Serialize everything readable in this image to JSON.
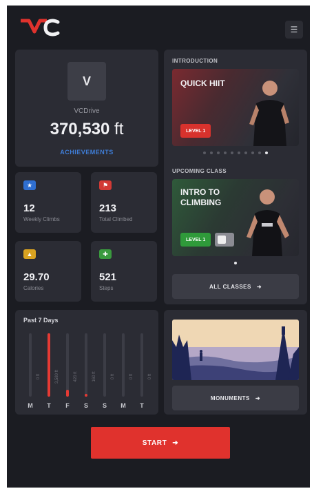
{
  "header": {
    "logo_text": "VC",
    "menu_icon": "menu-icon"
  },
  "profile": {
    "avatar_letter": "V",
    "username": "VCDrive",
    "total_value": "370,530",
    "total_unit": "ft",
    "achievements_label": "ACHIEVEMENTS"
  },
  "stats": [
    {
      "value": "12",
      "label": "Weekly Climbs",
      "icon": "trophy-icon",
      "color": "#2f6fd1"
    },
    {
      "value": "213",
      "label": "Total Climbed",
      "icon": "flag-icon",
      "color": "#d23a35"
    },
    {
      "value": "29.70",
      "label": "Calories",
      "icon": "flame-icon",
      "color": "#d9a321"
    },
    {
      "value": "521",
      "label": "Steps",
      "icon": "bolt-icon",
      "color": "#3a9a3e"
    }
  ],
  "past_days": {
    "title": "Past 7 Days",
    "days": [
      "M",
      "T",
      "F",
      "S",
      "S",
      "M",
      "T"
    ],
    "values": [
      0,
      100,
      11,
      4,
      0,
      0,
      0
    ],
    "value_labels": [
      "0 ft",
      "3,580 ft",
      "420 ft",
      "160 ft",
      "0 ft",
      "0 ft",
      "0 ft"
    ]
  },
  "classes": {
    "introduction_label": "INTRODUCTION",
    "intro_title": "QUICK HIIT",
    "intro_badge": "LEVEL 1",
    "upcoming_label": "UPCOMING CLASS",
    "upcoming_title_line1": "INTRO TO",
    "upcoming_title_line2": "CLIMBING",
    "upcoming_badge": "LEVEL 1",
    "all_classes_label": "ALL CLASSES",
    "intro_dots": 10,
    "intro_active_dot": 9,
    "upcoming_dots": 1
  },
  "monuments": {
    "label": "MONUMENTS"
  },
  "start": {
    "label": "START"
  },
  "colors": {
    "accent": "#e0322d",
    "background": "#1b1c22",
    "card": "#2b2c34"
  }
}
